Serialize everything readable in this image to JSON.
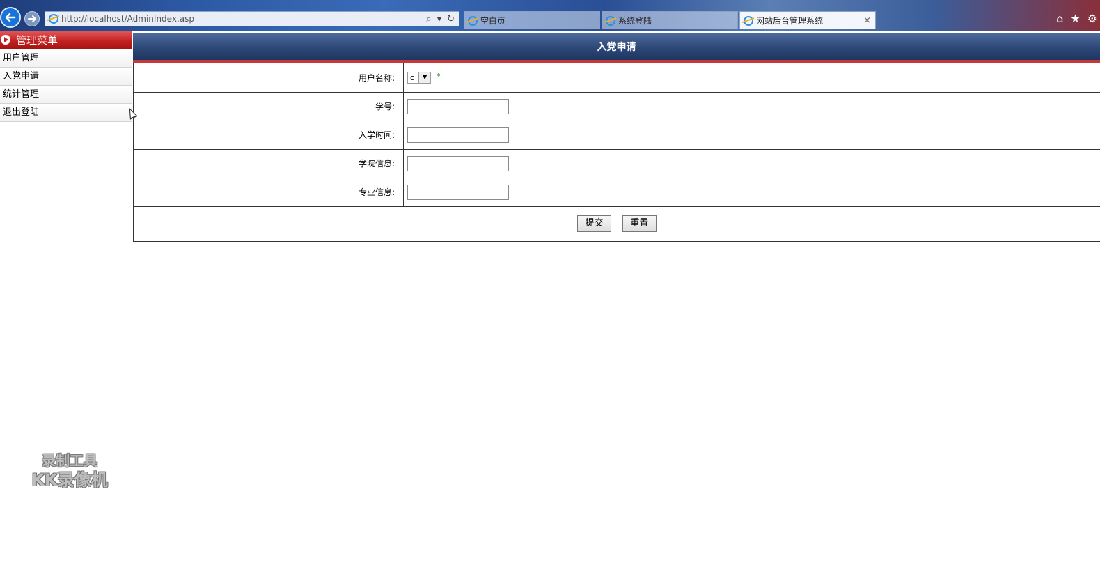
{
  "browser": {
    "address_url": "http://localhost/AdminIndex.asp",
    "tabs": [
      {
        "label": "空白页",
        "active": false
      },
      {
        "label": "系统登陆",
        "active": false
      },
      {
        "label": "网站后台管理系统",
        "active": true
      }
    ],
    "tab_close_glyph": "×"
  },
  "sidebar": {
    "header": "管理菜单",
    "items": [
      {
        "label": "用户管理"
      },
      {
        "label": "入党申请"
      },
      {
        "label": "统计管理"
      },
      {
        "label": "退出登陆"
      }
    ]
  },
  "main": {
    "title": "入党申请",
    "fields": [
      {
        "label": "用户名称:",
        "type": "select",
        "value": "c",
        "required_mark": "*"
      },
      {
        "label": "学号:",
        "type": "text",
        "value": ""
      },
      {
        "label": "入学时间:",
        "type": "text",
        "value": ""
      },
      {
        "label": "学院信息:",
        "type": "text",
        "value": ""
      },
      {
        "label": "专业信息:",
        "type": "text",
        "value": ""
      }
    ],
    "submit_label": "提交",
    "reset_label": "重置"
  },
  "watermark": {
    "line1": "录制工具",
    "line2": "KK录像机"
  },
  "colors": {
    "menu_header": "#c21f1f",
    "title_bar": "#2d4877",
    "title_accent": "#c43a3a"
  }
}
